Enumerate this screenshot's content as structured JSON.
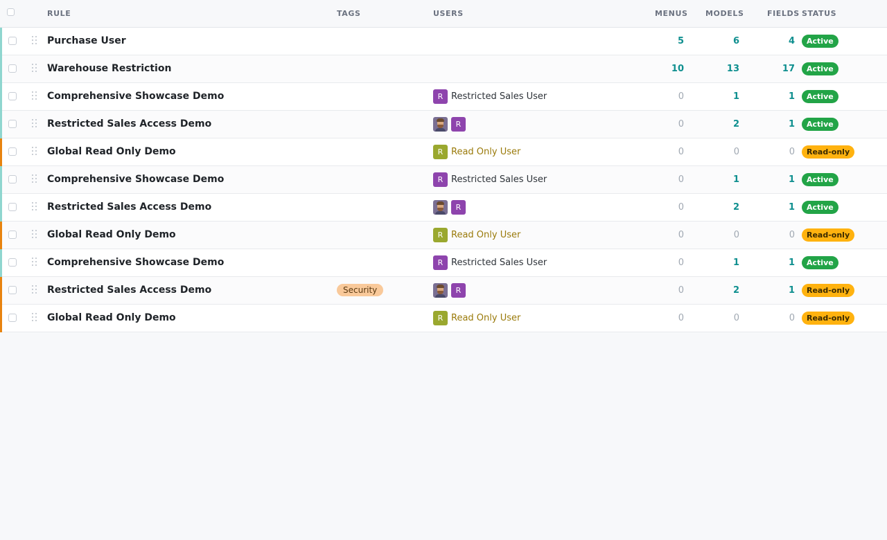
{
  "header": {
    "rule": "RULE",
    "tags": "TAGS",
    "users": "USERS",
    "menus": "MENUS",
    "models": "MODELS",
    "fields": "FIELDS",
    "status": "STATUS"
  },
  "colors": {
    "active_stripe": "#8fd6cf",
    "readonly_stripe": "#e8830f",
    "active_badge": "#22a447",
    "readonly_badge": "#ffb20f",
    "count_teal": "#0f8f8f",
    "avatar_purple": "#8e44ad",
    "avatar_olive": "#9aa82f",
    "tag_security": "#f9c99a"
  },
  "rows": [
    {
      "rule": "Purchase User",
      "tag": "",
      "users": [],
      "menus": "5",
      "models": "6",
      "fields": "4",
      "status": "Active",
      "status_kind": "active"
    },
    {
      "rule": "Warehouse Restriction",
      "tag": "",
      "users": [],
      "menus": "10",
      "models": "13",
      "fields": "17",
      "status": "Active",
      "status_kind": "active"
    },
    {
      "rule": "Comprehensive Showcase Demo",
      "tag": "",
      "users": [
        {
          "avatar": "R",
          "avatar_kind": "purple",
          "name": "Restricted Sales User",
          "name_kind": "dark"
        }
      ],
      "menus": "0",
      "models": "1",
      "fields": "1",
      "status": "Active",
      "status_kind": "active"
    },
    {
      "rule": "Restricted Sales Access Demo",
      "tag": "",
      "users": [
        {
          "avatar": "",
          "avatar_kind": "photo",
          "name": ""
        },
        {
          "avatar": "R",
          "avatar_kind": "purple",
          "name": ""
        }
      ],
      "menus": "0",
      "models": "2",
      "fields": "1",
      "status": "Active",
      "status_kind": "active"
    },
    {
      "rule": "Global Read Only Demo",
      "tag": "",
      "users": [
        {
          "avatar": "R",
          "avatar_kind": "olive",
          "name": "Read Only User",
          "name_kind": "gold"
        }
      ],
      "menus": "0",
      "models": "0",
      "fields": "0",
      "status": "Read-only",
      "status_kind": "readonly"
    },
    {
      "rule": "Comprehensive Showcase Demo",
      "tag": "",
      "users": [
        {
          "avatar": "R",
          "avatar_kind": "purple",
          "name": "Restricted Sales User",
          "name_kind": "dark"
        }
      ],
      "menus": "0",
      "models": "1",
      "fields": "1",
      "status": "Active",
      "status_kind": "active"
    },
    {
      "rule": "Restricted Sales Access Demo",
      "tag": "",
      "users": [
        {
          "avatar": "",
          "avatar_kind": "photo",
          "name": ""
        },
        {
          "avatar": "R",
          "avatar_kind": "purple",
          "name": ""
        }
      ],
      "menus": "0",
      "models": "2",
      "fields": "1",
      "status": "Active",
      "status_kind": "active"
    },
    {
      "rule": "Global Read Only Demo",
      "tag": "",
      "users": [
        {
          "avatar": "R",
          "avatar_kind": "olive",
          "name": "Read Only User",
          "name_kind": "gold"
        }
      ],
      "menus": "0",
      "models": "0",
      "fields": "0",
      "status": "Read-only",
      "status_kind": "readonly"
    },
    {
      "rule": "Comprehensive Showcase Demo",
      "tag": "",
      "users": [
        {
          "avatar": "R",
          "avatar_kind": "purple",
          "name": "Restricted Sales User",
          "name_kind": "dark"
        }
      ],
      "menus": "0",
      "models": "1",
      "fields": "1",
      "status": "Active",
      "status_kind": "active"
    },
    {
      "rule": "Restricted Sales Access Demo",
      "tag": "Security",
      "users": [
        {
          "avatar": "",
          "avatar_kind": "photo",
          "name": ""
        },
        {
          "avatar": "R",
          "avatar_kind": "purple",
          "name": ""
        }
      ],
      "menus": "0",
      "models": "2",
      "fields": "1",
      "status": "Read-only",
      "status_kind": "readonly"
    },
    {
      "rule": "Global Read Only Demo",
      "tag": "",
      "users": [
        {
          "avatar": "R",
          "avatar_kind": "olive",
          "name": "Read Only User",
          "name_kind": "gold"
        }
      ],
      "menus": "0",
      "models": "0",
      "fields": "0",
      "status": "Read-only",
      "status_kind": "readonly"
    }
  ]
}
